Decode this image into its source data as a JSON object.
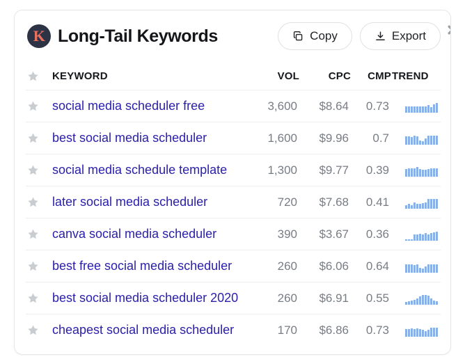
{
  "header": {
    "logo_letter": "K",
    "title": "Long-Tail Keywords",
    "copy_label": "Copy",
    "export_label": "Export",
    "close_label": "✖"
  },
  "table": {
    "columns": {
      "star": "",
      "keyword": "KEYWORD",
      "vol": "VOL",
      "cpc": "CPC",
      "cmp": "CMP",
      "trend": "TREND"
    },
    "rows": [
      {
        "keyword": "social media scheduler free",
        "vol": "3,600",
        "cpc": "$8.64",
        "cmp": "0.73",
        "trend": [
          9,
          9,
          9,
          9,
          9,
          9,
          9,
          9,
          11,
          8,
          12,
          14
        ]
      },
      {
        "keyword": "best social media scheduler",
        "vol": "1,600",
        "cpc": "$9.96",
        "cmp": "0.7",
        "trend": [
          12,
          12,
          11,
          13,
          12,
          6,
          5,
          9,
          13,
          13,
          13,
          13
        ]
      },
      {
        "keyword": "social media schedule template",
        "vol": "1,300",
        "cpc": "$9.77",
        "cmp": "0.39",
        "trend": [
          11,
          12,
          12,
          12,
          14,
          11,
          10,
          10,
          11,
          12,
          12,
          12
        ]
      },
      {
        "keyword": "later social media scheduler",
        "vol": "720",
        "cpc": "$7.68",
        "cmp": "0.41",
        "trend": [
          5,
          7,
          5,
          9,
          7,
          7,
          8,
          9,
          14,
          14,
          14,
          14
        ]
      },
      {
        "keyword": "canva social media scheduler",
        "vol": "390",
        "cpc": "$3.67",
        "cmp": "0.36",
        "trend": [
          2,
          2,
          2,
          9,
          9,
          10,
          9,
          11,
          9,
          11,
          12,
          13
        ]
      },
      {
        "keyword": "best free social media scheduler",
        "vol": "260",
        "cpc": "$6.06",
        "cmp": "0.64",
        "trend": [
          12,
          12,
          12,
          11,
          12,
          7,
          6,
          9,
          12,
          12,
          12,
          12
        ]
      },
      {
        "keyword": "best social media scheduler 2020",
        "vol": "260",
        "cpc": "$6.91",
        "cmp": "0.55",
        "trend": [
          4,
          5,
          6,
          7,
          9,
          12,
          14,
          14,
          13,
          9,
          6,
          5
        ]
      },
      {
        "keyword": "cheapest social media scheduler",
        "vol": "170",
        "cpc": "$6.86",
        "cmp": "0.73",
        "trend": [
          11,
          11,
          12,
          11,
          12,
          11,
          10,
          8,
          10,
          13,
          13,
          13
        ]
      }
    ]
  },
  "colors": {
    "keyword_link": "#2b20ab",
    "metric_text": "#787d85",
    "spark_bar": "#8ab0e8",
    "logo_bg": "#2b3344",
    "logo_letter": "#e8705f",
    "star": "#c9ccd1"
  }
}
